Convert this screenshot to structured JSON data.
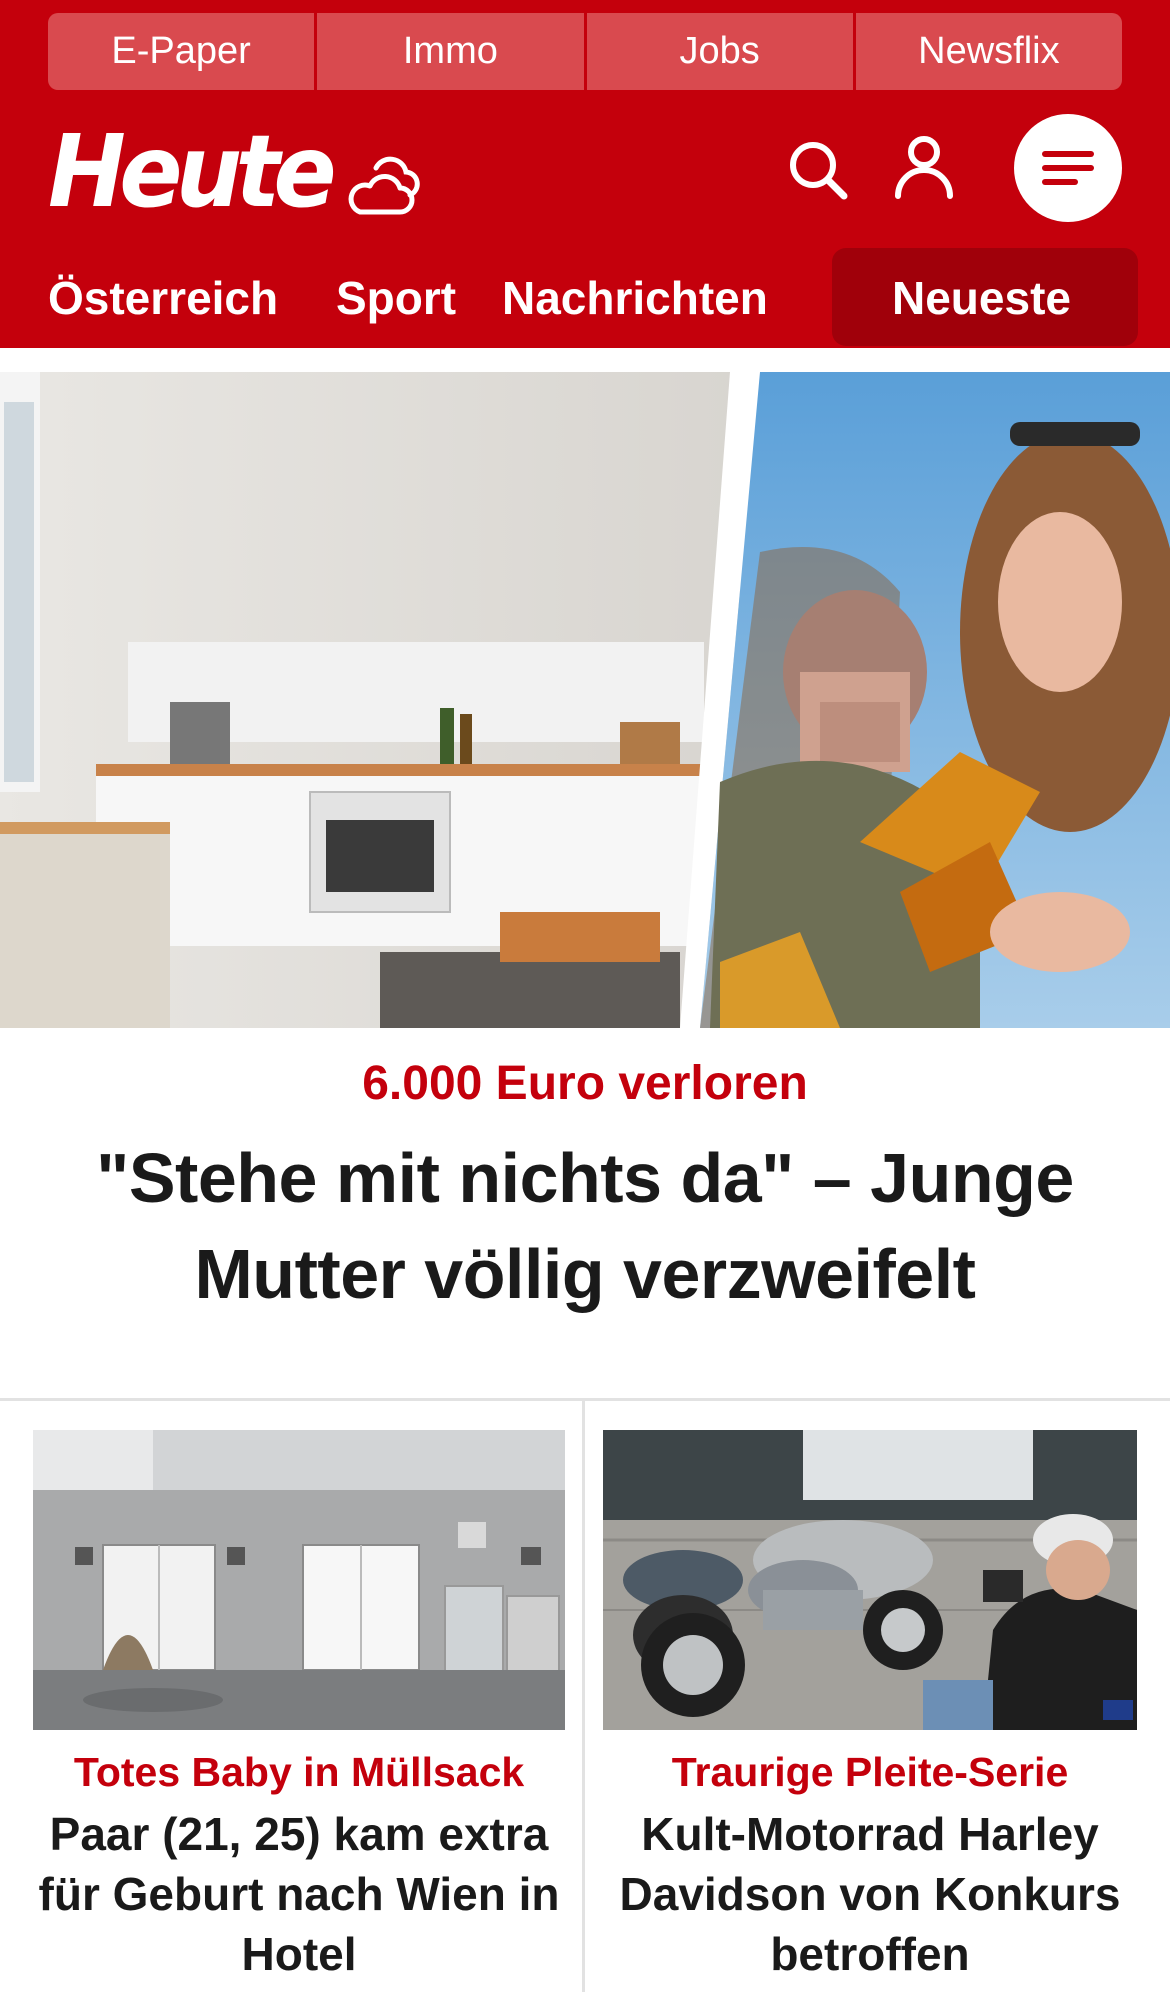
{
  "top_links": [
    "E-Paper",
    "Immo",
    "Jobs",
    "Newsflix"
  ],
  "brand": {
    "logo_text": "Heute",
    "color_primary": "#c4000c",
    "color_tab": "#d94a4f",
    "color_highlight": "#a0000a"
  },
  "header_icons": [
    "weather-cloud-icon",
    "search-icon",
    "user-icon",
    "menu-icon"
  ],
  "nav": {
    "items": [
      "Österreich",
      "Sport",
      "Nachrichten",
      "Neueste"
    ],
    "active": "Neueste"
  },
  "hero": {
    "kicker": "6.000 Euro verloren",
    "headline": "\"Stehe mit nichts da\" – Junge Mutter völlig verzweifelt"
  },
  "articles": [
    {
      "kicker": "Totes Baby in Müllsack",
      "title": "Paar (21, 25) kam extra für Geburt nach Wien in Hotel"
    },
    {
      "kicker": "Traurige Pleite-Serie",
      "title": "Kult-Motorrad Harley Davidson von Konkurs betroffen"
    }
  ]
}
